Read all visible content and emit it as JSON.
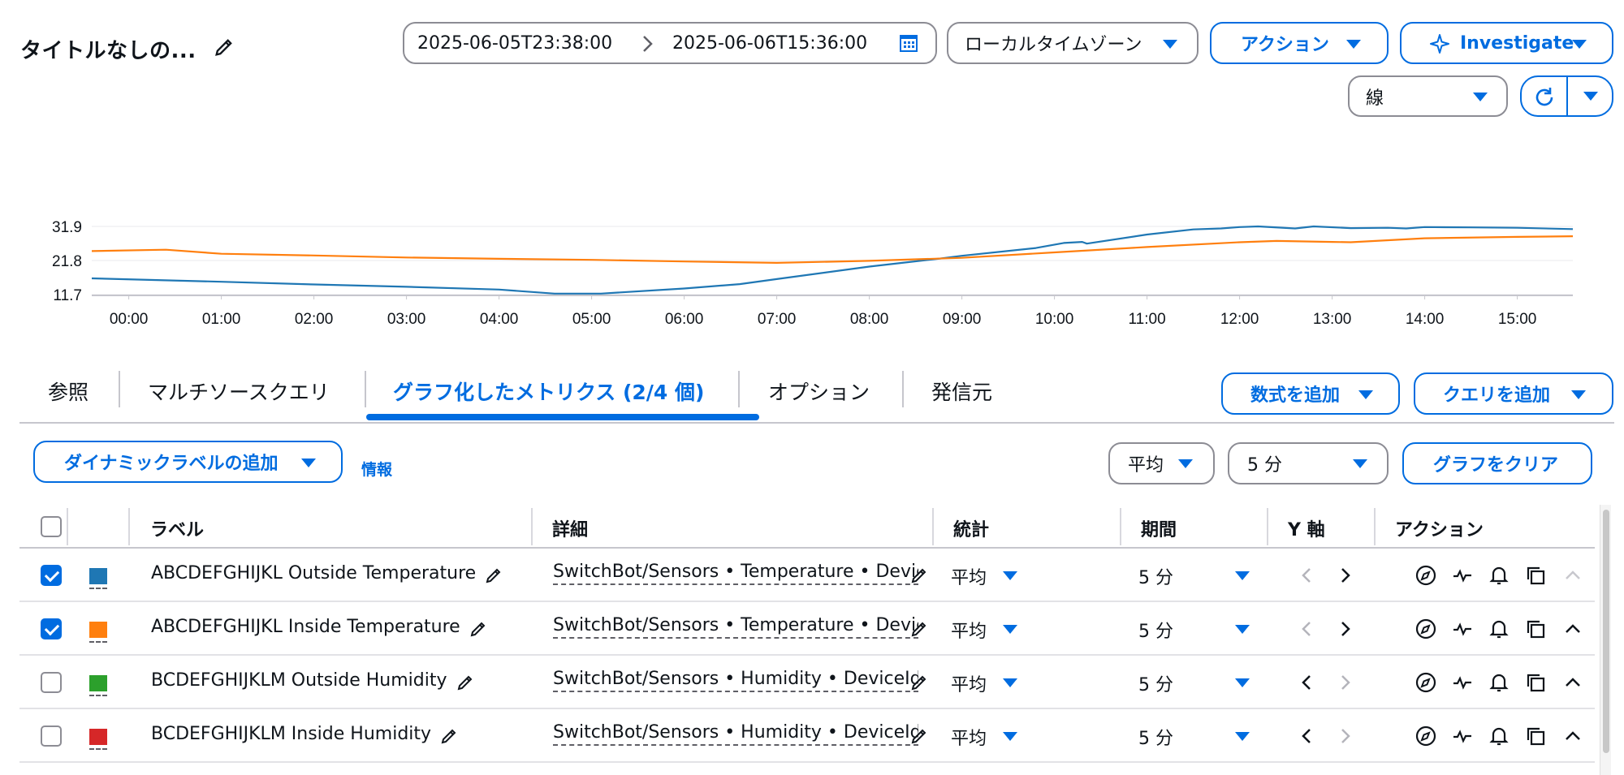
{
  "header": {
    "title": "タイトルなしの...",
    "date_start": "2025-06-05T23:38:00",
    "date_end": "2025-06-06T15:36:00",
    "timezone": "ローカルタイムゾーン",
    "actions_label": "アクション",
    "investigate_label": "Investigate",
    "graph_type": "線"
  },
  "chart_data": {
    "type": "line",
    "y_ticks": [
      "31.9",
      "21.8",
      "11.7"
    ],
    "x_ticks": [
      "00:00",
      "01:00",
      "02:00",
      "03:00",
      "04:00",
      "05:00",
      "06:00",
      "07:00",
      "08:00",
      "09:00",
      "10:00",
      "11:00",
      "12:00",
      "13:00",
      "14:00",
      "15:00"
    ],
    "ylim": [
      11.7,
      31.9
    ],
    "x_range_hours": [
      -0.4,
      15.6
    ],
    "series": [
      {
        "color": "#1f77b4",
        "points": [
          [
            -0.4,
            16.5
          ],
          [
            1,
            15.5
          ],
          [
            2,
            14.7
          ],
          [
            3,
            14.0
          ],
          [
            4,
            13.2
          ],
          [
            4.6,
            12.0
          ],
          [
            5.1,
            12.0
          ],
          [
            6,
            13.5
          ],
          [
            6.6,
            14.8
          ],
          [
            7,
            16.3
          ],
          [
            8,
            20.0
          ],
          [
            8.8,
            22.5
          ],
          [
            9,
            23.2
          ],
          [
            9.8,
            25.5
          ],
          [
            10.1,
            27.0
          ],
          [
            10.3,
            27.3
          ],
          [
            10.35,
            26.8
          ],
          [
            11,
            29.5
          ],
          [
            11.5,
            31.0
          ],
          [
            11.8,
            31.3
          ],
          [
            12,
            31.7
          ],
          [
            12.2,
            31.9
          ],
          [
            12.6,
            31.3
          ],
          [
            12.8,
            31.9
          ],
          [
            13.2,
            31.4
          ],
          [
            13.6,
            31.5
          ],
          [
            13.8,
            31.3
          ],
          [
            14,
            31.7
          ],
          [
            14.5,
            31.6
          ],
          [
            15,
            31.5
          ],
          [
            15.6,
            31.1
          ]
        ]
      },
      {
        "color": "#ff7f0e",
        "points": [
          [
            -0.4,
            24.6
          ],
          [
            0.4,
            25.0
          ],
          [
            1,
            23.8
          ],
          [
            2,
            23.3
          ],
          [
            3,
            22.7
          ],
          [
            4,
            22.3
          ],
          [
            5,
            22.0
          ],
          [
            6,
            21.5
          ],
          [
            7,
            21.1
          ],
          [
            8,
            21.7
          ],
          [
            9,
            22.6
          ],
          [
            10,
            24.2
          ],
          [
            11,
            25.8
          ],
          [
            12,
            27.2
          ],
          [
            12.4,
            27.6
          ],
          [
            13,
            27.3
          ],
          [
            13.2,
            27.2
          ],
          [
            14,
            28.4
          ],
          [
            15,
            28.8
          ],
          [
            15.6,
            29.0
          ]
        ]
      }
    ]
  },
  "tabs": [
    {
      "label": "参照"
    },
    {
      "label": "マルチソースクエリ"
    },
    {
      "label": "グラフ化したメトリクス (2/4 個)"
    },
    {
      "label": "オプション"
    },
    {
      "label": "発信元"
    }
  ],
  "tab_buttons": {
    "add_formula": "数式を追加",
    "add_query": "クエリを追加"
  },
  "toolbar": {
    "dynamic_label": "ダイナミックラベルの追加",
    "info": "情報",
    "stat": "平均",
    "period": "5 分",
    "clear_graph": "グラフをクリア"
  },
  "table": {
    "headers": {
      "label": "ラベル",
      "details": "詳細",
      "statistic": "統計",
      "period": "期間",
      "y_axis": "Y 軸",
      "actions": "アクション"
    },
    "rows": [
      {
        "checked": true,
        "color": "#1f77b4",
        "label": "ABCDEFGHIJKL Outside Temperature",
        "details": "SwitchBot/Sensors • Temperature • Devic",
        "stat": "平均",
        "period": "5 分"
      },
      {
        "checked": true,
        "color": "#ff7f0e",
        "label": "ABCDEFGHIJKL Inside Temperature",
        "details": "SwitchBot/Sensors • Temperature • Devic",
        "stat": "平均",
        "period": "5 分"
      },
      {
        "checked": false,
        "color": "#2ca02c",
        "label": "BCDEFGHIJKLM Outside Humidity",
        "details": "SwitchBot/Sensors • Humidity • DeviceId:",
        "stat": "平均",
        "period": "5 分"
      },
      {
        "checked": false,
        "color": "#d62728",
        "label": "BCDEFGHIJKLM Inside Humidity",
        "details": "SwitchBot/Sensors • Humidity • DeviceId:",
        "stat": "平均",
        "period": "5 分"
      }
    ]
  }
}
